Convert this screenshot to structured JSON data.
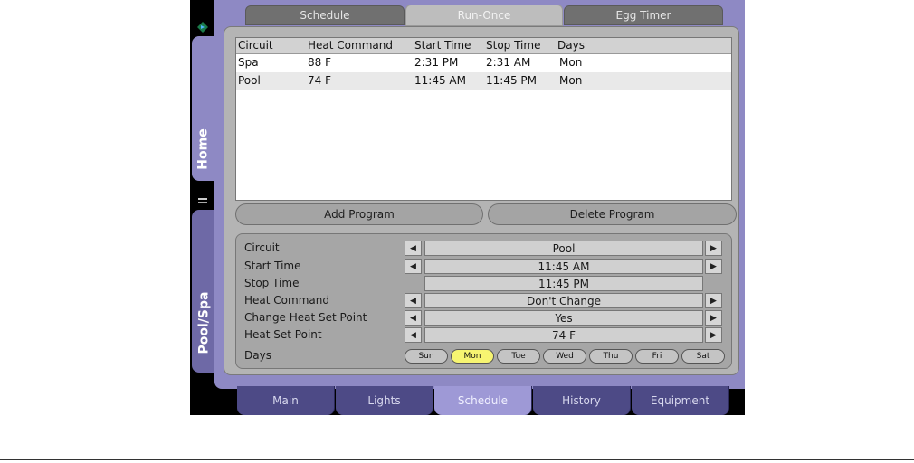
{
  "sidebar": {
    "tabs": [
      {
        "label": "Home",
        "icon": "diamond-arrow-icon"
      },
      {
        "label": "Pool/Spa",
        "icon": "pool-icon"
      }
    ]
  },
  "top_tabs": [
    "Schedule",
    "Run-Once",
    "Egg Timer"
  ],
  "table": {
    "headers": [
      "Circuit",
      "Heat Command",
      "Start Time",
      "Stop Time",
      "Days"
    ],
    "rows": [
      [
        "Spa",
        "88 F",
        "2:31 PM",
        "2:31 AM",
        "Mon"
      ],
      [
        "Pool",
        "74 F",
        "11:45 AM",
        "11:45 PM",
        "Mon"
      ]
    ]
  },
  "buttons": {
    "add": "Add Program",
    "delete": "Delete Program"
  },
  "form": {
    "circuit_label": "Circuit",
    "circuit_value": "Pool",
    "start_label": "Start Time",
    "start_value": "11:45 AM",
    "stop_label": "Stop Time",
    "stop_value": "11:45 PM",
    "heat_cmd_label": "Heat Command",
    "heat_cmd_value": "Don't Change",
    "change_label": "Change Heat Set Point",
    "change_value": "Yes",
    "setpoint_label": "Heat Set Point",
    "setpoint_value": "74 F",
    "days_label": "Days",
    "days": [
      "Sun",
      "Mon",
      "Tue",
      "Wed",
      "Thu",
      "Fri",
      "Sat"
    ],
    "selected_day": "Mon"
  },
  "bottom_tabs": [
    "Main",
    "Lights",
    "Schedule",
    "History",
    "Equipment"
  ],
  "colors": {
    "accent": "#8e89c4",
    "selected_day": "#f7f571",
    "active_bottom_tab": "#9e99d6"
  }
}
